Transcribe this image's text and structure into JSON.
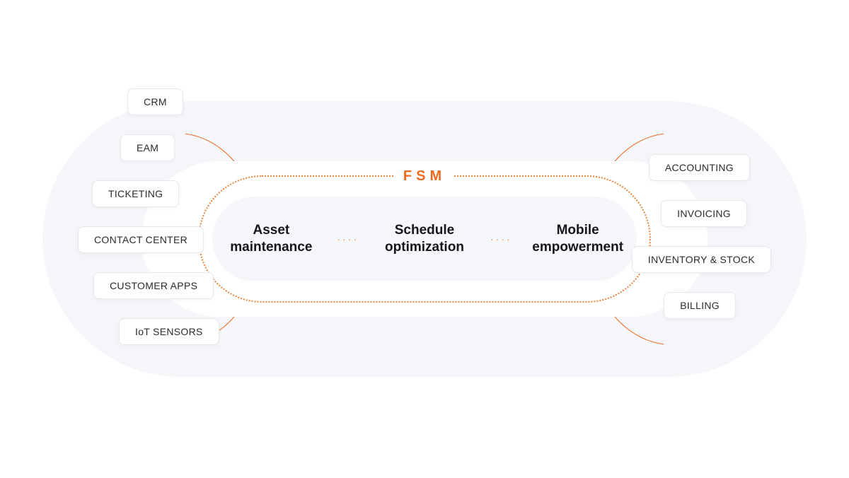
{
  "diagram": {
    "center_label": "FSM",
    "core": [
      "Asset\nmaintenance",
      "Schedule\noptimization",
      "Mobile\nempowerment"
    ],
    "left_items": [
      "CRM",
      "EAM",
      "TICKETING",
      "CONTACT CENTER",
      "CUSTOMER APPS",
      "IoT SENSORS"
    ],
    "right_items": [
      "ACCOUNTING",
      "INVOICING",
      "INVENTORY & STOCK",
      "BILLING"
    ]
  }
}
